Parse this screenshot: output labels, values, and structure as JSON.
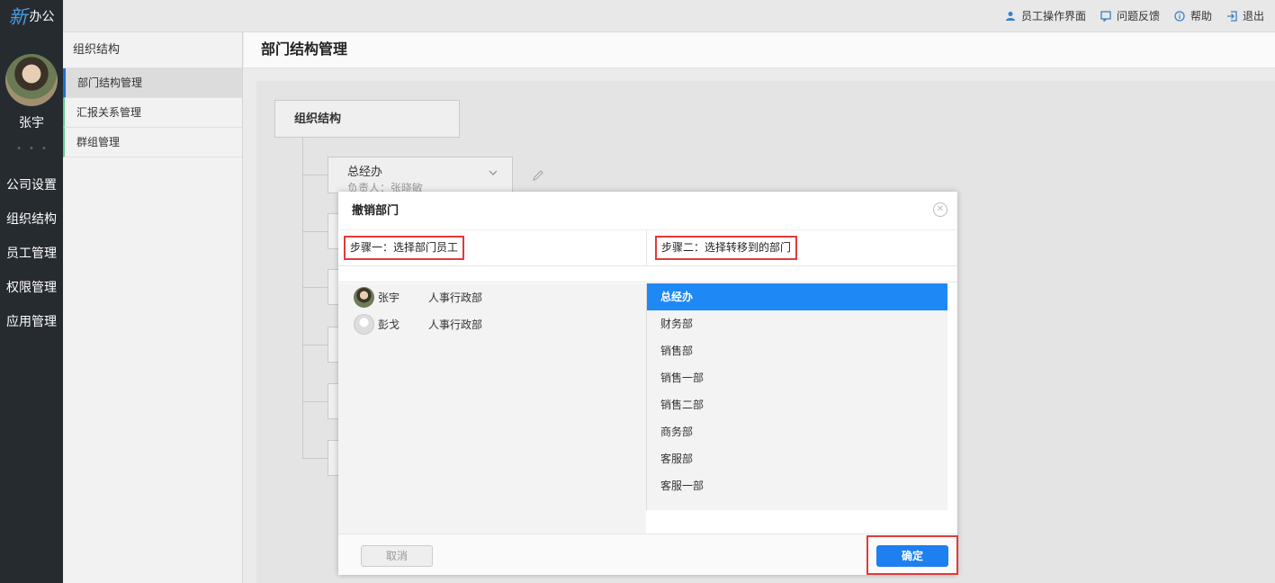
{
  "logo": {
    "xin": "新",
    "rest": "办公"
  },
  "user": {
    "name": "张宇"
  },
  "leftnav": [
    "公司设置",
    "组织结构",
    "员工管理",
    "权限管理",
    "应用管理"
  ],
  "topbar": [
    {
      "label": "员工操作界面",
      "icon": "user-icon"
    },
    {
      "label": "问题反馈",
      "icon": "feedback-icon"
    },
    {
      "label": "帮助",
      "icon": "info-icon"
    },
    {
      "label": "退出",
      "icon": "logout-icon"
    }
  ],
  "subnav": {
    "header": "组织结构",
    "items": [
      "部门结构管理",
      "汇报关系管理",
      "群组管理"
    ]
  },
  "page": {
    "title": "部门结构管理"
  },
  "org": {
    "root": "组织结构",
    "node": {
      "name": "总经办",
      "leader": "负责人：张晓敏"
    }
  },
  "modal": {
    "title": "撤销部门",
    "step1": "步骤一：选择部门员工",
    "step2": "步骤二：选择转移到的部门",
    "employees": [
      {
        "name": "张宇",
        "dept": "人事行政部"
      },
      {
        "name": "彭戈",
        "dept": "人事行政部"
      }
    ],
    "departments": [
      "总经办",
      "财务部",
      "销售部",
      "销售一部",
      "销售二部",
      "商务部",
      "客服部",
      "客服一部"
    ],
    "cancel": "取消",
    "confirm": "确定"
  },
  "colors": {
    "accent": "#1e7ff0",
    "highlight": "#e23a3a",
    "sidebar": "#262b30"
  }
}
